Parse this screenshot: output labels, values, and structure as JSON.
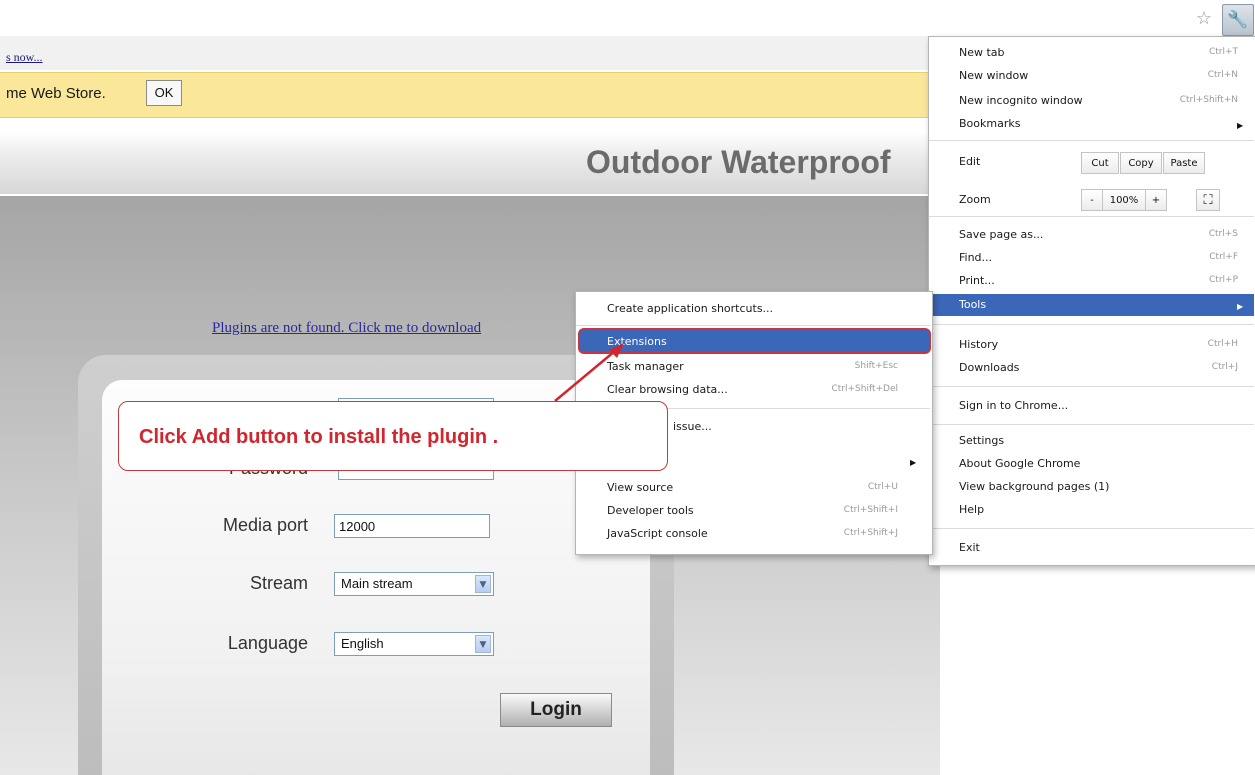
{
  "browser": {
    "infobar_link": "s now...",
    "infobar_text": "me Web Store.",
    "ok_label": "OK",
    "star_glyph": "☆",
    "wrench_glyph": "🔧"
  },
  "page": {
    "title": "Outdoor Waterproof",
    "plugin_link": "Plugins are not found. Click me to download"
  },
  "login": {
    "password_label": "Password",
    "media_port_label": "Media port",
    "media_port_value": "12000",
    "stream_label": "Stream",
    "stream_value": "Main stream",
    "language_label": "Language",
    "language_value": "English",
    "login_button": "Login",
    "dropdown_glyph": "▼"
  },
  "callout": {
    "text": "Click Add button to install the plugin ."
  },
  "chrome_menu": {
    "new_tab": "New tab",
    "new_tab_shortcut": "Ctrl+T",
    "new_window": "New window",
    "new_window_shortcut": "Ctrl+N",
    "new_incognito": "New incognito window",
    "new_incognito_shortcut": "Ctrl+Shift+N",
    "bookmarks": "Bookmarks",
    "edit": "Edit",
    "cut": "Cut",
    "copy": "Copy",
    "paste": "Paste",
    "zoom": "Zoom",
    "zoom_minus": "-",
    "zoom_value": "100%",
    "zoom_plus": "+",
    "fullscreen_glyph": "⛶",
    "save_page": "Save page as...",
    "save_shortcut": "Ctrl+S",
    "find": "Find...",
    "find_shortcut": "Ctrl+F",
    "print": "Print...",
    "print_shortcut": "Ctrl+P",
    "tools": "Tools",
    "history": "History",
    "history_shortcut": "Ctrl+H",
    "downloads": "Downloads",
    "downloads_shortcut": "Ctrl+J",
    "sign_in": "Sign in to Chrome...",
    "settings": "Settings",
    "about": "About Google Chrome",
    "background_pages": "View background pages (1)",
    "help": "Help",
    "exit": "Exit",
    "submenu_arrow": "▶"
  },
  "tools_menu": {
    "create_shortcuts": "Create application shortcuts...",
    "extensions": "Extensions",
    "task_manager": "Task manager",
    "task_manager_shortcut": "Shift+Esc",
    "clear_data": "Clear browsing data...",
    "clear_data_shortcut": "Ctrl+Shift+Del",
    "report_issue_tail": "issue...",
    "view_source": "View source",
    "view_source_shortcut": "Ctrl+U",
    "developer_tools": "Developer tools",
    "developer_tools_shortcut": "Ctrl+Shift+I",
    "js_console": "JavaScript console",
    "js_console_shortcut": "Ctrl+Shift+J"
  },
  "colors": {
    "menu_highlight": "#3b67b8",
    "annotation_red": "#d0262d",
    "infobar_yellow": "#fbe79a"
  }
}
